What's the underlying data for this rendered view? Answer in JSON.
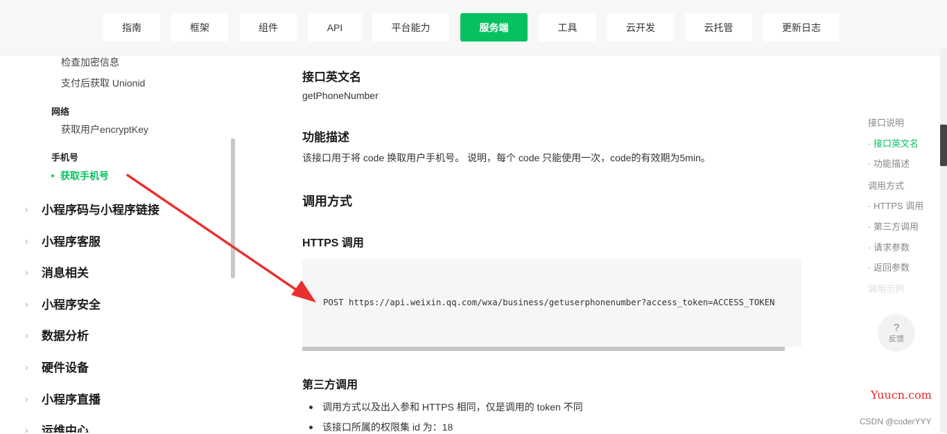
{
  "nav": {
    "tabs": [
      "指南",
      "框架",
      "组件",
      "API",
      "平台能力",
      "服务端",
      "工具",
      "云开发",
      "云托管",
      "更新日志"
    ],
    "active": "服务端"
  },
  "sidebar": {
    "sub_items_top": [
      "检查加密信息",
      "支付后获取 Unionid"
    ],
    "group_network": "网络",
    "network_item": "获取用户encryptKey",
    "group_phone": "手机号",
    "active_item": "获取手机号",
    "top_items": [
      "小程序码与小程序链接",
      "小程序客服",
      "消息相关",
      "小程序安全",
      "数据分析",
      "硬件设备",
      "小程序直播",
      "运维中心"
    ]
  },
  "main": {
    "api_name_title": "接口英文名",
    "api_name": "getPhoneNumber",
    "desc_title": "功能描述",
    "desc_text": "该接口用于将 code 换取用户手机号。 说明，每个 code 只能使用一次，code的有效期为5min。",
    "call_title": "调用方式",
    "https_title": "HTTPS 调用",
    "code_line": "POST https://api.weixin.qq.com/wxa/business/getuserphonenumber?access_token=ACCESS_TOKEN",
    "third_title": "第三方调用",
    "bullets": [
      "调用方式以及出入参和 HTTPS 相同，仅是调用的 token 不同",
      "该接口所属的权限集 id 为：18"
    ]
  },
  "toc": {
    "items": [
      "接口说明",
      "· 接口英文名",
      "· 功能描述",
      "调用方式",
      "· HTTPS 调用",
      "· 第三方调用",
      "· 请求参数",
      "· 返回参数",
      "调用示例"
    ]
  },
  "feedback": {
    "icon": "?",
    "label": "反馈"
  },
  "watermark": {
    "site": "Yuucn.com",
    "author": "CSDN @coderYYY"
  },
  "colors": {
    "accent": "#07c160",
    "arrow": "#e8312f"
  }
}
